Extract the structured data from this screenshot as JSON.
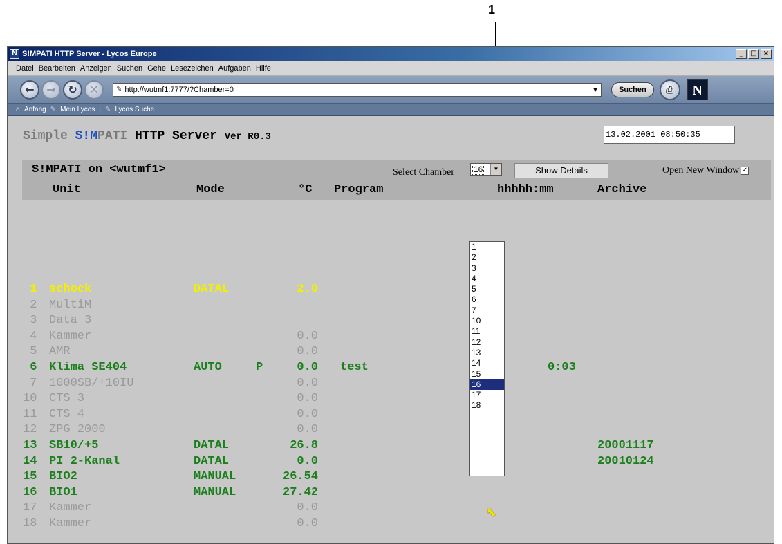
{
  "callout": {
    "number": "1"
  },
  "window": {
    "title": "S!MPATI HTTP Server - Lycos Europe",
    "app_icon": "N",
    "controls": {
      "minimize": "_",
      "maximize": "□",
      "close": "×"
    }
  },
  "menu": [
    "Datei",
    "Bearbeiten",
    "Anzeigen",
    "Suchen",
    "Gehe",
    "Lesezeichen",
    "Aufgaben",
    "Hilfe"
  ],
  "nav": {
    "url": "http://wutmf1:7777/?Chamber=0",
    "search_label": "Suchen",
    "logo": "N",
    "back_icon": "←",
    "forward_icon": "→",
    "reload_icon": "↻",
    "stop_icon": "✕"
  },
  "bookmarks": [
    "Anfang",
    "Mein Lycos",
    "Lycos Suche"
  ],
  "page": {
    "title_prefix": "Simple ",
    "title_brand_blue": "S!M",
    "title_mid": "PATI",
    "title_tail": " HTTP Server ",
    "title_version": "Ver R0.3",
    "datetime": "13.02.2001 08:50:35"
  },
  "panel": {
    "host_title": "S!MPATI on <wutmf1>",
    "select_label": "Select Chamber",
    "selected_chamber": "16",
    "show_details": "Show Details",
    "open_new_window": "Open New Window",
    "open_new_checked": "✓"
  },
  "columns": {
    "unit": "Unit",
    "mode": "Mode",
    "temp": "°C",
    "program": "Program",
    "time": "hhhhh:mm",
    "archive": "Archive"
  },
  "rows": [
    {
      "num": " 1",
      "unit": "schock",
      "mode": "DATAL",
      "flag": "",
      "temp": "2.0",
      "program": "",
      "time": "",
      "archive": "",
      "state": "yellow"
    },
    {
      "num": " 2",
      "unit": "MultiM",
      "mode": "",
      "flag": "",
      "temp": "",
      "program": "",
      "time": "",
      "archive": "",
      "state": "gray"
    },
    {
      "num": " 3",
      "unit": "Data 3",
      "mode": "",
      "flag": "",
      "temp": "",
      "program": "",
      "time": "",
      "archive": "",
      "state": "gray"
    },
    {
      "num": " 4",
      "unit": "Kammer",
      "mode": "",
      "flag": "",
      "temp": "0.0",
      "program": "",
      "time": "",
      "archive": "",
      "state": "gray"
    },
    {
      "num": " 5",
      "unit": "AMR",
      "mode": "",
      "flag": "",
      "temp": "0.0",
      "program": "",
      "time": "",
      "archive": "",
      "state": "gray"
    },
    {
      "num": " 6",
      "unit": "Klima SE404",
      "mode": "AUTO",
      "flag": "P",
      "temp": "0.0",
      "program": "test",
      "time": "0:03",
      "archive": "",
      "state": "green"
    },
    {
      "num": " 7",
      "unit": "1000SB/+10IU",
      "mode": "",
      "flag": "",
      "temp": "0.0",
      "program": "",
      "time": "",
      "archive": "",
      "state": "gray"
    },
    {
      "num": "10",
      "unit": "CTS 3",
      "mode": "",
      "flag": "",
      "temp": "0.0",
      "program": "",
      "time": "",
      "archive": "",
      "state": "gray"
    },
    {
      "num": "11",
      "unit": "CTS 4",
      "mode": "",
      "flag": "",
      "temp": "0.0",
      "program": "",
      "time": "",
      "archive": "",
      "state": "gray"
    },
    {
      "num": "12",
      "unit": "ZPG 2000",
      "mode": "",
      "flag": "",
      "temp": "0.0",
      "program": "",
      "time": "",
      "archive": "",
      "state": "gray"
    },
    {
      "num": "13",
      "unit": "SB10/+5",
      "mode": "DATAL",
      "flag": "",
      "temp": "26.8",
      "program": "",
      "time": "",
      "archive": "20001117",
      "state": "green"
    },
    {
      "num": "14",
      "unit": "PI 2-Kanal",
      "mode": "DATAL",
      "flag": "",
      "temp": "0.0",
      "program": "",
      "time": "",
      "archive": "20010124",
      "state": "green"
    },
    {
      "num": "15",
      "unit": "BIO2",
      "mode": "MANUAL",
      "flag": "",
      "temp": "26.54",
      "program": "",
      "time": "",
      "archive": "",
      "state": "green"
    },
    {
      "num": "16",
      "unit": "BIO1",
      "mode": "MANUAL",
      "flag": "",
      "temp": "27.42",
      "program": "",
      "time": "",
      "archive": "",
      "state": "green"
    },
    {
      "num": "17",
      "unit": "Kammer",
      "mode": "",
      "flag": "",
      "temp": "0.0",
      "program": "",
      "time": "",
      "archive": "",
      "state": "gray"
    },
    {
      "num": "18",
      "unit": "Kammer",
      "mode": "",
      "flag": "",
      "temp": "0.0",
      "program": "",
      "time": "",
      "archive": "",
      "state": "gray"
    }
  ],
  "dropdown_options": [
    "1",
    "2",
    "3",
    "4",
    "5",
    "6",
    "7",
    "10",
    "11",
    "12",
    "13",
    "14",
    "15",
    "16",
    "17",
    "18"
  ],
  "dropdown_selected": "16",
  "colors": {
    "active_row": "#1b7f1b",
    "alarm_row": "#f2f000",
    "inactive_row": "#9a9a9a",
    "brand": "#2050c0"
  }
}
